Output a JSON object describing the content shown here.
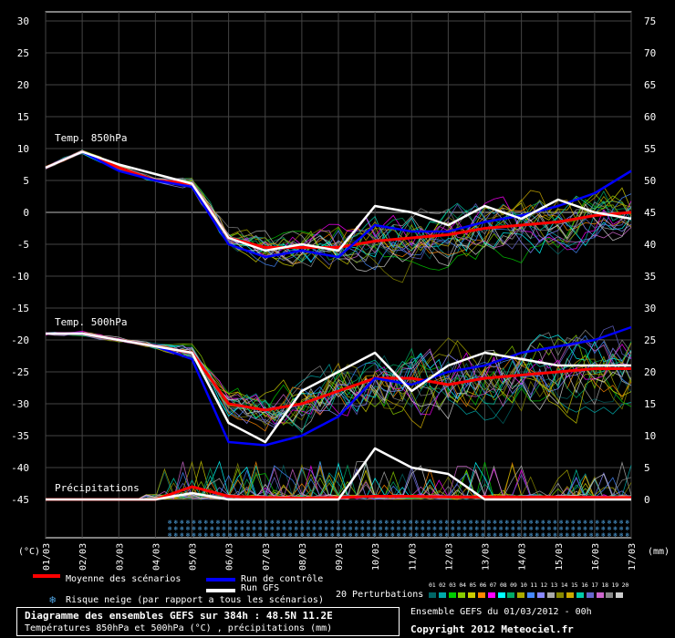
{
  "chart_data": {
    "type": "line",
    "title": "Diagramme des ensembles GEFS sur 384h : 48.5N 11.2E",
    "subtitle": "Températures 850hPa et 500hPa (°C) , précipitations (mm)",
    "x_labels": [
      "01/03",
      "02/03",
      "03/03",
      "04/03",
      "05/03",
      "06/03",
      "07/03",
      "08/03",
      "09/03",
      "10/03",
      "11/03",
      "12/03",
      "13/03",
      "14/03",
      "15/03",
      "16/03",
      "17/03"
    ],
    "y_left_ticks": [
      30,
      25,
      20,
      15,
      10,
      5,
      0,
      -5,
      -10,
      -15,
      -20,
      -25,
      -30,
      -35,
      -40,
      -45
    ],
    "y_right_ticks": [
      75,
      70,
      65,
      60,
      55,
      50,
      45,
      40,
      35,
      30,
      25,
      20,
      15,
      10,
      5,
      0
    ],
    "y_left_unit": "(°C)",
    "y_right_unit": "(mm)",
    "ylim_left": [
      -45,
      30
    ],
    "panel_labels": {
      "t850": "Temp. 850hPa",
      "t500": "Temp. 500hPa",
      "precip": "Précipitations"
    },
    "series": [
      {
        "name": "Moyenne des scénarios",
        "panel": "t850",
        "color": "#ff0000",
        "values": [
          7,
          9.5,
          7,
          5,
          4.5,
          -4,
          -5.5,
          -5.5,
          -5.5,
          -4.5,
          -4,
          -3.5,
          -2.5,
          -2,
          -1.5,
          -0.5,
          0
        ]
      },
      {
        "name": "Run de contrôle",
        "panel": "t850",
        "color": "#0000ff",
        "values": [
          7,
          9.5,
          6.5,
          5,
          4,
          -5,
          -7,
          -6,
          -7,
          -2,
          -3,
          -3,
          -1.5,
          -0.5,
          1,
          3,
          6.5
        ]
      },
      {
        "name": "Run GFS",
        "panel": "t850",
        "color": "#ffffff",
        "values": [
          7,
          9.5,
          7.5,
          6,
          4.5,
          -4,
          -6,
          -5,
          -6,
          1,
          0,
          -2,
          1,
          -1,
          2,
          0,
          -1
        ]
      },
      {
        "name": "Moyenne des scénarios",
        "panel": "t500",
        "color": "#ff0000",
        "values": [
          -19,
          -19,
          -20,
          -21,
          -22,
          -30,
          -31,
          -30,
          -28,
          -26,
          -26,
          -27,
          -26,
          -25.5,
          -25,
          -24.5,
          -24.5
        ]
      },
      {
        "name": "Run de contrôle",
        "panel": "t500",
        "color": "#0000ff",
        "values": [
          -19,
          -19,
          -20,
          -21,
          -23,
          -36,
          -36.5,
          -35,
          -32,
          -26,
          -27,
          -25,
          -24,
          -22,
          -21,
          -20,
          -18
        ]
      },
      {
        "name": "Run GFS",
        "panel": "t500",
        "color": "#ffffff",
        "values": [
          -19,
          -19,
          -20,
          -21,
          -22,
          -33,
          -36,
          -28,
          -25,
          -22,
          -28,
          -24,
          -22,
          -23,
          -24,
          -24,
          -24
        ]
      },
      {
        "name": "Moyenne des scénarios",
        "panel": "precip",
        "color": "#ff0000",
        "values": [
          0,
          0,
          0,
          0,
          2,
          0.5,
          0.3,
          0.2,
          0.3,
          0.5,
          0.5,
          0.4,
          0.4,
          0.4,
          0.4,
          0.3,
          0.3
        ]
      },
      {
        "name": "Run GFS",
        "panel": "precip",
        "color": "#ffffff",
        "values": [
          0,
          0,
          0,
          0,
          1,
          0,
          0,
          0,
          0,
          8,
          5,
          4,
          0,
          0,
          0,
          0,
          0
        ]
      }
    ],
    "perturbation_colors": [
      "#006666",
      "#00aaaa",
      "#00cc00",
      "#88cc00",
      "#cccc00",
      "#ff8800",
      "#ff00ff",
      "#00ffff",
      "#00aa66",
      "#aaaa00",
      "#4488ff",
      "#8888ff",
      "#aaaaaa",
      "#888800",
      "#ccaa00",
      "#00ccaa",
      "#6666cc",
      "#cc66cc",
      "#888888",
      "#cccccc"
    ],
    "grid": true
  },
  "legend": {
    "mean": "Moyenne des scénarios",
    "control": "Run de contrôle",
    "gfs": "Run GFS",
    "perturbations": "20 Perturbations",
    "pert_numbers": "01 02 03 04 05 06 07 08 09 10 11 12 13 14 15 16 17 18 19 20",
    "snow": "Risque neige (par rapport a tous les scénarios)"
  },
  "footer": {
    "title": "Diagramme des ensembles GEFS sur 384h : 48.5N 11.2E",
    "subtitle": "Températures 850hPa et 500hPa (°C) , précipitations (mm)",
    "run_info": "Ensemble GEFS du 01/03/2012 - 00h",
    "copyright": "Copyright 2012 Meteociel.fr"
  }
}
